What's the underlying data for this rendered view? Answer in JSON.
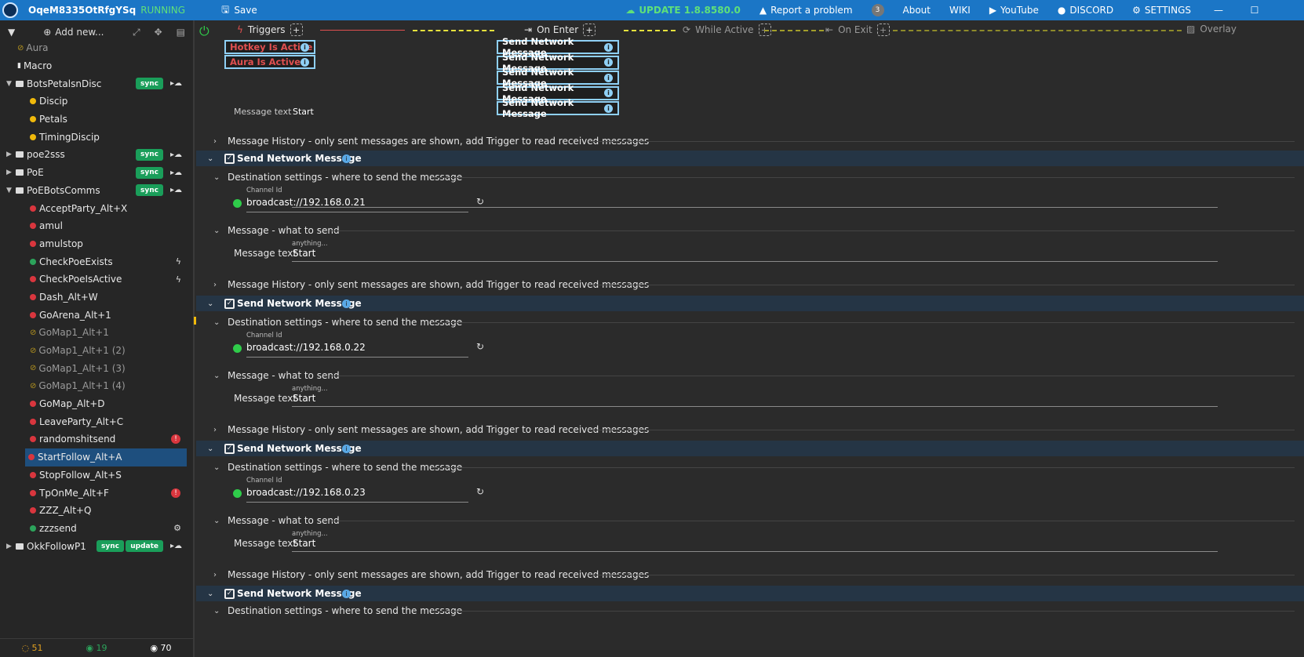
{
  "titlebar": {
    "app_name": "OqeM8335OtRfgYSq",
    "state": "RUNNING",
    "save_label": "Save",
    "update_label": "UPDATE 1.8.8580.0",
    "report_label": "Report a problem",
    "notif_count": "3",
    "about_label": "About",
    "wiki_label": "WIKI",
    "youtube_label": "YouTube",
    "discord_label": "DISCORD",
    "settings_label": "SETTINGS"
  },
  "sidebar": {
    "add_label": "Add new...",
    "items": [
      {
        "label": "Aura",
        "kind": "aura"
      },
      {
        "label": "Macro",
        "kind": "macro"
      },
      {
        "label": "BotsPetalsnDisc",
        "kind": "folder",
        "badge": "sync"
      },
      {
        "label": "Discip",
        "kind": "yellow"
      },
      {
        "label": "Petals",
        "kind": "yellow"
      },
      {
        "label": "TimingDiscip",
        "kind": "yellow"
      },
      {
        "label": "poe2sss",
        "kind": "folder",
        "badge": "sync"
      },
      {
        "label": "PoE",
        "kind": "folder",
        "badge": "sync"
      },
      {
        "label": "PoEBotsComms",
        "kind": "folder",
        "badge": "sync"
      },
      {
        "label": "AcceptParty_Alt+X",
        "kind": "red"
      },
      {
        "label": "amul",
        "kind": "red"
      },
      {
        "label": "amulstop",
        "kind": "red"
      },
      {
        "label": "CheckPoeExists",
        "kind": "green",
        "extra": "bolt"
      },
      {
        "label": "CheckPoeIsActive",
        "kind": "red",
        "extra": "bolt"
      },
      {
        "label": "Dash_Alt+W",
        "kind": "red"
      },
      {
        "label": "GoArena_Alt+1",
        "kind": "red"
      },
      {
        "label": "GoMap1_Alt+1",
        "kind": "hidden"
      },
      {
        "label": "GoMap1_Alt+1 (2)",
        "kind": "hidden"
      },
      {
        "label": "GoMap1_Alt+1 (3)",
        "kind": "hidden"
      },
      {
        "label": "GoMap1_Alt+1 (4)",
        "kind": "hidden"
      },
      {
        "label": "GoMap_Alt+D",
        "kind": "red"
      },
      {
        "label": "LeaveParty_Alt+C",
        "kind": "red"
      },
      {
        "label": "randomshitsend",
        "kind": "red",
        "extra": "flag"
      },
      {
        "label": "StartFollow_Alt+A",
        "kind": "red",
        "selected": true
      },
      {
        "label": "StopFollow_Alt+S",
        "kind": "red"
      },
      {
        "label": "TpOnMe_Alt+F",
        "kind": "red",
        "extra": "flag"
      },
      {
        "label": "ZZZ_Alt+Q",
        "kind": "red"
      },
      {
        "label": "zzzsend",
        "kind": "green",
        "extra": "gear"
      },
      {
        "label": "OkkFollowP1",
        "kind": "folder",
        "badge": "sync",
        "badge2": "update"
      }
    ],
    "footer": {
      "hidden_count": "51",
      "visible_count": "19",
      "total_count": "70"
    }
  },
  "flow": {
    "triggers_label": "Triggers",
    "on_enter_label": "On Enter",
    "while_active_label": "While Active",
    "on_exit_label": "On Exit",
    "overlay_label": "Overlay",
    "trigger_chips": [
      "Hotkey Is Active",
      "Aura Is Active"
    ],
    "enter_chips": [
      "Send Network Message",
      "Send Network Message",
      "Send Network Message",
      "Send Network Message",
      "Send Network Message"
    ]
  },
  "content": {
    "partial_message_label": "Message text",
    "partial_message_value": "Start",
    "history_label": "Message History - only sent messages are shown, add Trigger to read received messages",
    "section_title": "Send Network Message",
    "destination_label": "Destination settings - where to send the message",
    "channel_small": "Channel Id",
    "message_what_label": "Message - what to send",
    "message_text_label": "Message text",
    "anything_small": "anything...",
    "blocks": [
      {
        "channel": "broadcast://192.168.0.21",
        "message": "Start"
      },
      {
        "channel": "broadcast://192.168.0.22",
        "message": "Start"
      },
      {
        "channel": "broadcast://192.168.0.23",
        "message": "Start"
      }
    ]
  }
}
